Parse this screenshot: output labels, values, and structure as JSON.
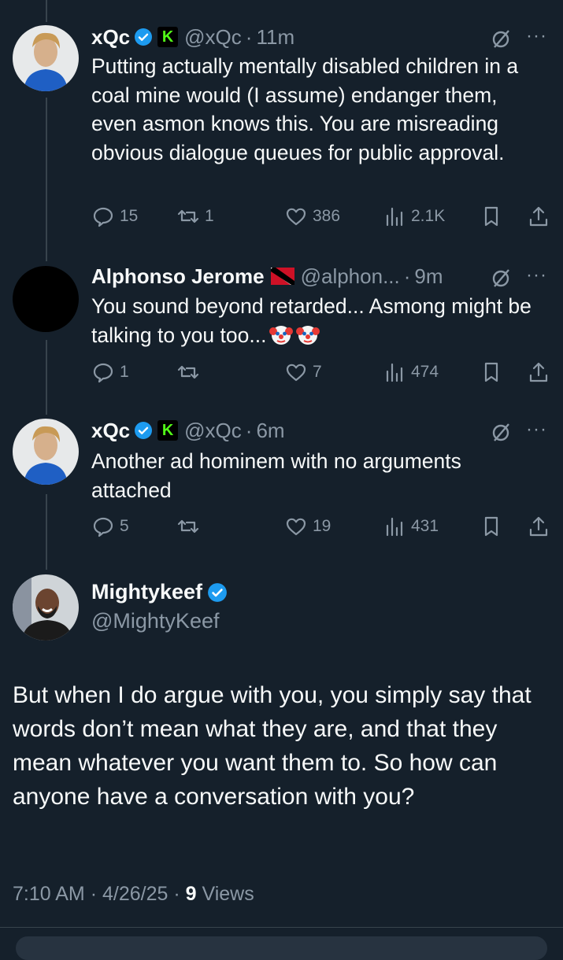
{
  "replies": [
    {
      "name": "xQc",
      "handle": "@xQc",
      "dot": "·",
      "time": "11m",
      "text": "Putting actually mentally disabled children in a coal mine would (I assume) endanger them, even asmon knows this. You are misreading obvious dialogue queues for public approval.",
      "replies": "15",
      "reposts": "1",
      "likes": "386",
      "views": "2.1K"
    },
    {
      "name": "Alphonso Jerome",
      "handle": "@alphon...",
      "dot": "·",
      "time": "9m",
      "text": "You sound beyond retarded... Asmong might be talking to you too...",
      "replies": "1",
      "reposts": "",
      "likes": "7",
      "views": "474"
    },
    {
      "name": "xQc",
      "handle": "@xQc",
      "dot": "·",
      "time": "6m",
      "text": "Another ad hominem with no arguments attached",
      "replies": "5",
      "reposts": "",
      "likes": "19",
      "views": "431"
    }
  ],
  "main": {
    "name": "Mightykeef",
    "handle": "@MightyKeef",
    "text": "But when I do argue with you, you simply say that words don’t mean what they are, and that they mean whatever you want them to. So how can anyone have a conversation with you?",
    "time": "7:10 AM",
    "date": "4/26/25",
    "views_count": "9",
    "views_label": "Views",
    "sep": "·"
  },
  "icons": {
    "kick_badge_letter": "K",
    "more": "···"
  },
  "colors": {
    "background": "#15202b",
    "text": "#f7f9f9",
    "muted": "#8b98a5",
    "verified": "#1d9bf0",
    "kick": "#53fc18"
  }
}
